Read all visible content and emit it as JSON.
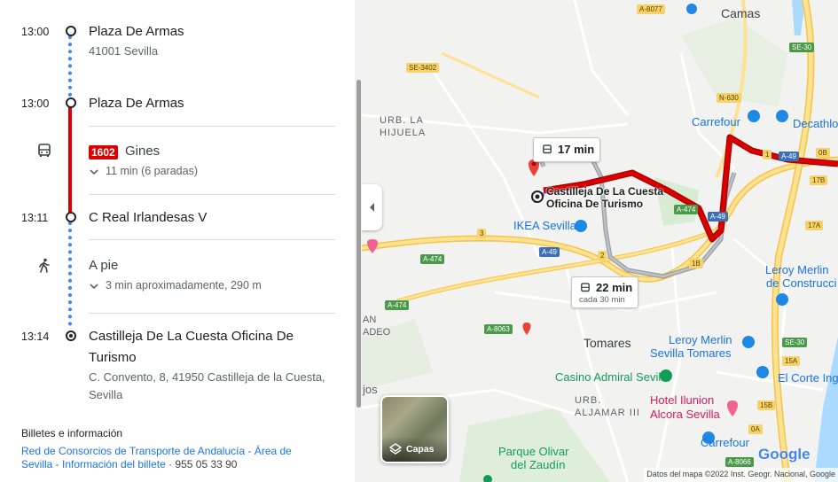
{
  "itinerary": {
    "stop1": {
      "time": "13:00",
      "name": "Plaza De Armas",
      "address": "41001 Sevilla"
    },
    "stop2": {
      "time": "13:00",
      "name": "Plaza De Armas"
    },
    "bus": {
      "line": "1602",
      "destination": "Gines",
      "detail": "11 min (6 paradas)"
    },
    "stop3": {
      "time": "13:11",
      "name": "C Real Irlandesas V"
    },
    "walk": {
      "label": "A pie",
      "detail": "3 min aproximadamente, 290 m"
    },
    "stop4": {
      "time": "13:14",
      "name_line1": "Castilleja De La Cuesta Oficina De",
      "name_line2": "Turismo",
      "address_line1": "C. Convento, 8, 41950 Castilleja de la Cuesta,",
      "address_line2": "Sevilla"
    }
  },
  "tickets": {
    "heading": "Billetes e información",
    "link_line1": "Red de Consorcios de Transporte de Andalucía - Área de",
    "link_line2": "Sevilla - Información del billete",
    "phone": " · 955 05 33 90"
  },
  "map": {
    "route_box1": "17 min",
    "route_box2_time": "22 min",
    "route_box2_sub": "cada 30 min",
    "destination_label_line1": "Castilleja De La Cuesta",
    "destination_label_line2": "Oficina De Turismo",
    "layers_label": "Capas",
    "attribution": "Datos del mapa ©2022 Inst. Geogr. Nacional, Google",
    "google": "Google",
    "places": {
      "camas": "Camas",
      "urb_la_hijuela_1": "URB. LA",
      "urb_la_hijuela_2": "HIJUELA",
      "ikea": "IKEA Sevilla",
      "carrefour1": "Carrefour",
      "decathlon": "Decathlo",
      "leroy1_1": "Leroy Merlin",
      "leroy1_2": "de Construcci",
      "tomares": "Tomares",
      "leroy2_1": "Leroy Merlin",
      "leroy2_2": "Sevilla Tomares",
      "casino": "Casino Admiral Sevilla",
      "corte": "El Corte Ing",
      "hotel1": "Hotel Ilunion",
      "hotel2": "Alcora Sevilla",
      "urb_aljamar_1": "URB.",
      "urb_aljamar_2": "ALJAMAR III",
      "parque1": "Parque Olivar",
      "parque2": "del Zaudín",
      "carrefour2": "Carrefour",
      "an": "AN",
      "adeo": "ADEO",
      "jos": "jos"
    },
    "roads": {
      "a8077": "A-8077",
      "se30a": "SE-30",
      "se3402": "SE-3402",
      "n630": "N-630",
      "a49a": "A-49",
      "a474a": "A-474",
      "a49b": "A-49",
      "a474b": "A-474",
      "a49c": "A-49",
      "a474c": "A-474",
      "a8063": "A-8063",
      "se30b": "SE-30",
      "a8066": "A-8066",
      "e1": "1",
      "e3": "3",
      "e2": "2",
      "e1b": "1B",
      "e17b": "17B",
      "e17a": "17A",
      "e0b": "0B",
      "e15a": "15A",
      "e15b": "15B",
      "e0a": "0A"
    },
    "colors": {
      "transit_line": "#db0000",
      "walk_line": "#4285f4",
      "route_alt": "#9aa0a6"
    }
  }
}
